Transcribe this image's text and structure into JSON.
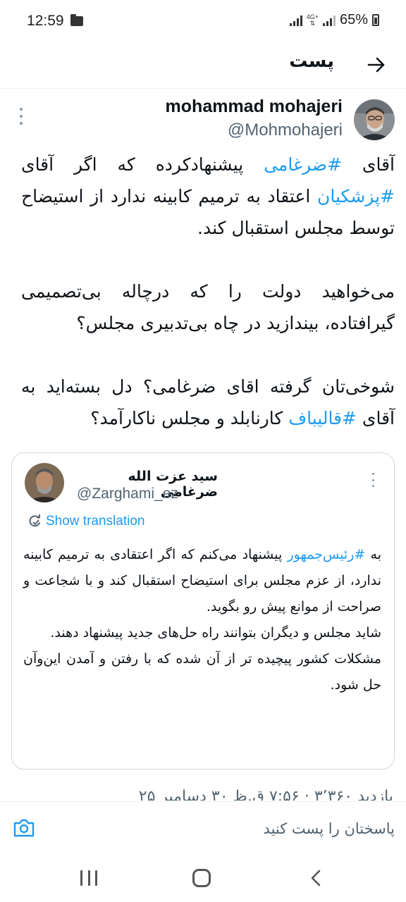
{
  "status_bar": {
    "time": "12:59",
    "network": "4G+",
    "battery": "65%",
    "icons": [
      "folder-icon",
      "signal-icon",
      "network-icon",
      "battery-icon"
    ]
  },
  "header": {
    "title": "پست",
    "back_icon": "arrow-right-icon"
  },
  "tweet": {
    "author_name": "mohammad mohajeri",
    "author_handle": "@Mohmohajeri",
    "paragraphs": [
      [
        {
          "text": "آقای ",
          "tag": false
        },
        {
          "text": "#ضرغامی",
          "tag": true
        },
        {
          "text": " پیشنهادکرده که اگر آقای ",
          "tag": false
        },
        {
          "text": "#پزشکیان",
          "tag": true
        },
        {
          "text": " اعتقاد به ترمیم کابینه ندارد از استیضاح توسط مجلس استقبال کند.",
          "tag": false
        }
      ],
      [
        {
          "text": "می‌خواهید دولت را که درچاله بی‌تصمیمی گیرافتاده، بیندازید در چاه بی‌تدبیری مجلس؟",
          "tag": false
        }
      ],
      [
        {
          "text": "شوخی‌تان گرفته اقای ضرغامی؟ دل بسته‌اید به آقای ",
          "tag": false
        },
        {
          "text": "#قالیباف",
          "tag": true
        },
        {
          "text": " کارنابلد و مجلس ناکارآمد؟",
          "tag": false
        }
      ]
    ]
  },
  "quoted": {
    "author_name": "سید عزت الله ضرغامی",
    "author_handle": "@Zarghami_ez",
    "translate_label": "Show translation",
    "paragraphs": [
      [
        {
          "text": "به ",
          "tag": false
        },
        {
          "text": "#رئیس‌جمهور",
          "tag": true
        },
        {
          "text": " پیشنهاد می‌کنم که اگر اعتقادی به ترمیم کابینه ندارد، از عزم مجلس برای استیضاح استقبال کند و با شجاعت و صراحت از موانع پیش رو بگوید.",
          "tag": false
        }
      ],
      [
        {
          "text": "شاید مجلس و دیگران بتوانند راه حل‌های جدید پیشنهاد دهند.",
          "tag": false
        }
      ],
      [
        {
          "text": "مشکلات کشور پیچیده تر از آن شده که با رفتن و آمدن این‌وآن حل شود.",
          "tag": false
        }
      ]
    ]
  },
  "stats_line": "بازدید ۳٬۳۶۰ · ۷:۵۶ ق.ظ ۳۰ دسامبر ۲۵",
  "reply": {
    "placeholder": "پاسختان را پست کنید"
  },
  "colors": {
    "link": "#1d9bf0",
    "text": "#0f1419",
    "muted": "#536471",
    "border": "#cfd9de"
  }
}
